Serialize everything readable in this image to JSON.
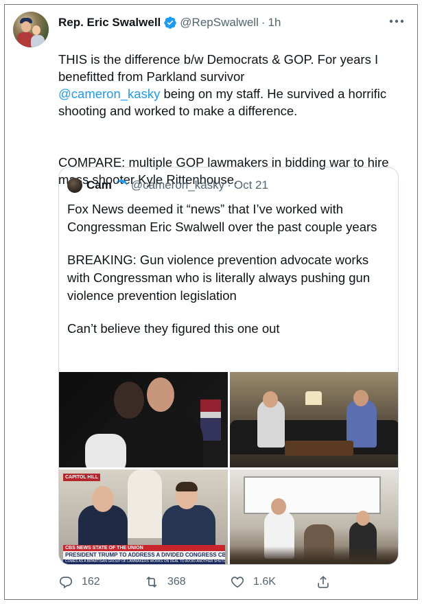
{
  "tweet": {
    "display_name": "Rep. Eric Swalwell",
    "handle": "@RepSwalwell",
    "separator": "·",
    "time": "1h",
    "text_lines_before_mention": "THIS is the difference b/w Democrats & GOP. For years I benefitted from Parkland survivor",
    "mention": "@cameron_kasky",
    "text_after_mention": " being on my staff. He survived a horrific shooting and worked to make a difference.",
    "text_compare": "COMPARE: multiple GOP lawmakers in bidding war to hire mass shooter Kyle Rittenhouse.",
    "icons": {
      "verified": "verified-badge-icon",
      "more": "more-options-icon"
    }
  },
  "quoted_tweet": {
    "display_name": "Cam",
    "handle": "@cameron_kasky",
    "separator": "·",
    "date": "Oct 21",
    "paragraphs": [
      "Fox News deemed it “news” that I’ve worked with Congressman Eric Swalwell over the past couple years",
      "BREAKING: Gun violence prevention advocate works with Congressman who is literally always pushing gun violence prevention legislation",
      "Can’t believe they figured this one out"
    ],
    "media": {
      "photo3_overlay": {
        "tag": "CAPITOL HILL",
        "bar_top": "CBS NEWS  STATE OF THE UNION",
        "headline": "PRESIDENT TRUMP TO ADDRESS A DIVIDED CONGRESS  CBSN",
        "subline": "COMES AS A BIPARTISAN GROUP OF LAWMAKERS WORKS ON DEAL TO AVOID ANOTHER SHUTDOWN"
      }
    }
  },
  "actions": {
    "reply_count": "162",
    "retweet_count": "368",
    "like_count": "1.6K",
    "icons": [
      "reply-icon",
      "retweet-icon",
      "like-icon",
      "share-icon"
    ]
  },
  "colors": {
    "text": "#0f1419",
    "secondary": "#536471",
    "link": "#1d9bf0",
    "border": "#cfd9de"
  }
}
